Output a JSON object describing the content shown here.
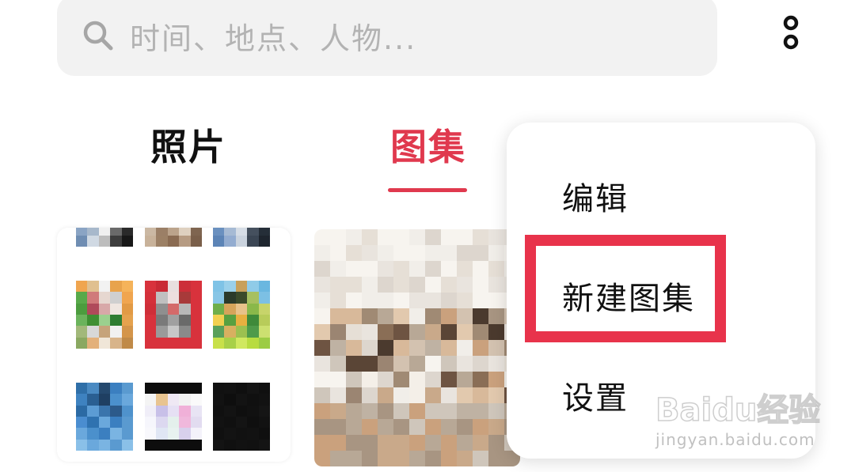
{
  "search": {
    "placeholder": "时间、地点、人物..."
  },
  "tabs": {
    "photos_label": "照片",
    "albums_label": "图集",
    "active": "图集"
  },
  "popup_menu": {
    "items": [
      {
        "label": "编辑"
      },
      {
        "label": "新建图集"
      },
      {
        "label": "设置"
      }
    ],
    "highlighted_item": "新建图集"
  },
  "watermark": {
    "brand": "Baidu经验",
    "url": "jingyan.baidu.com"
  },
  "colors": {
    "accent": "#e0394e",
    "highlight": "#e8334b",
    "search_bg": "#f2f2f2",
    "placeholder_text": "#b3b3b3"
  },
  "icons": {
    "search": "search-icon",
    "more": "more-vertical-icon"
  }
}
